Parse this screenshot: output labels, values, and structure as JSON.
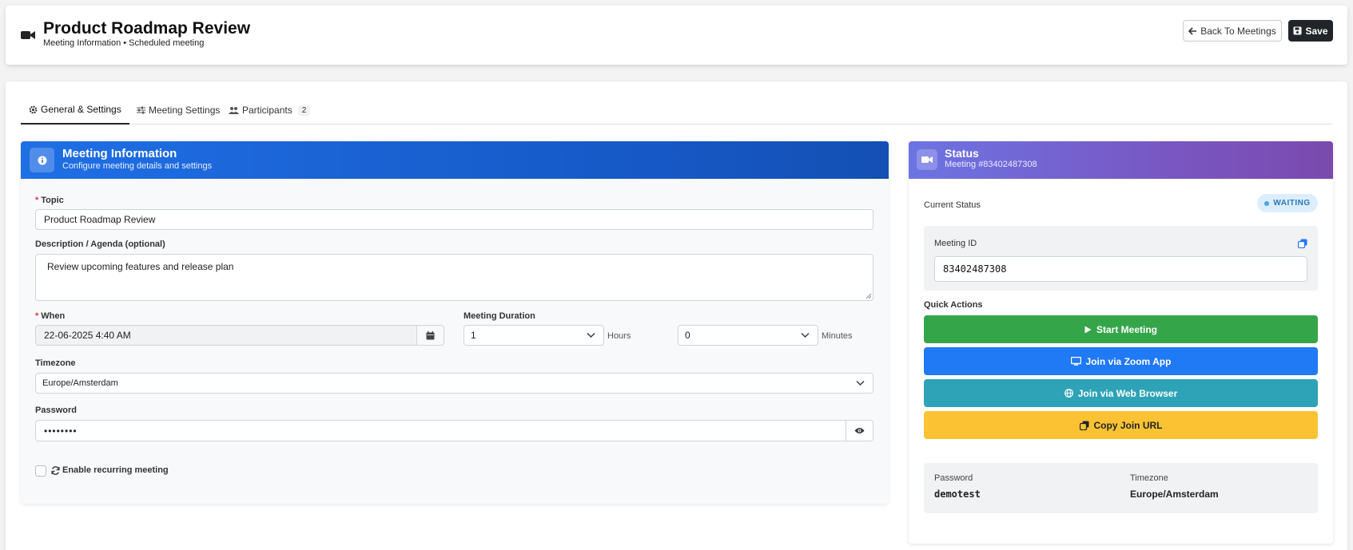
{
  "header": {
    "title": "Product Roadmap Review",
    "subtitle": "Meeting Information • Scheduled meeting",
    "back_label": "Back To Meetings",
    "save_label": "Save"
  },
  "tabs": [
    {
      "label": "General & Settings",
      "active": true
    },
    {
      "label": "Meeting Settings",
      "active": false
    },
    {
      "label": "Participants",
      "badge": "2",
      "active": false
    }
  ],
  "info_panel": {
    "title": "Meeting Information",
    "subtitle": "Configure meeting details and settings",
    "topic_label": "Topic",
    "topic_value": "Product Roadmap Review",
    "desc_label": "Description / Agenda (optional)",
    "desc_value": "Review upcoming features and release plan",
    "when_label": "When",
    "when_value": "22-06-2025 4:40 AM",
    "duration_label": "Meeting Duration",
    "hours_value": "1",
    "hours_unit": "Hours",
    "minutes_value": "0",
    "minutes_unit": "Minutes",
    "timezone_label": "Timezone",
    "timezone_value": "Europe/Amsterdam",
    "password_label": "Password",
    "password_value": "••••••••",
    "recurring_label": "Enable recurring meeting"
  },
  "status_panel": {
    "title": "Status",
    "subtitle": "Meeting #83402487308",
    "current_status_label": "Current Status",
    "status_badge": "WAITING",
    "meeting_id_label": "Meeting ID",
    "meeting_id_value": "83402487308",
    "quick_actions_label": "Quick Actions",
    "actions": {
      "start": "Start Meeting",
      "zoom": "Join via Zoom App",
      "browser": "Join via Web Browser",
      "copy": "Copy Join URL"
    },
    "password_label": "Password",
    "password_value": "demotest",
    "timezone_label": "Timezone",
    "timezone_value": "Europe/Amsterdam"
  },
  "colors": {
    "start": "#35a54a",
    "zoom": "#2079f5",
    "browser": "#2ea3b7",
    "copy": "#fbc233",
    "dark": "#212529"
  }
}
